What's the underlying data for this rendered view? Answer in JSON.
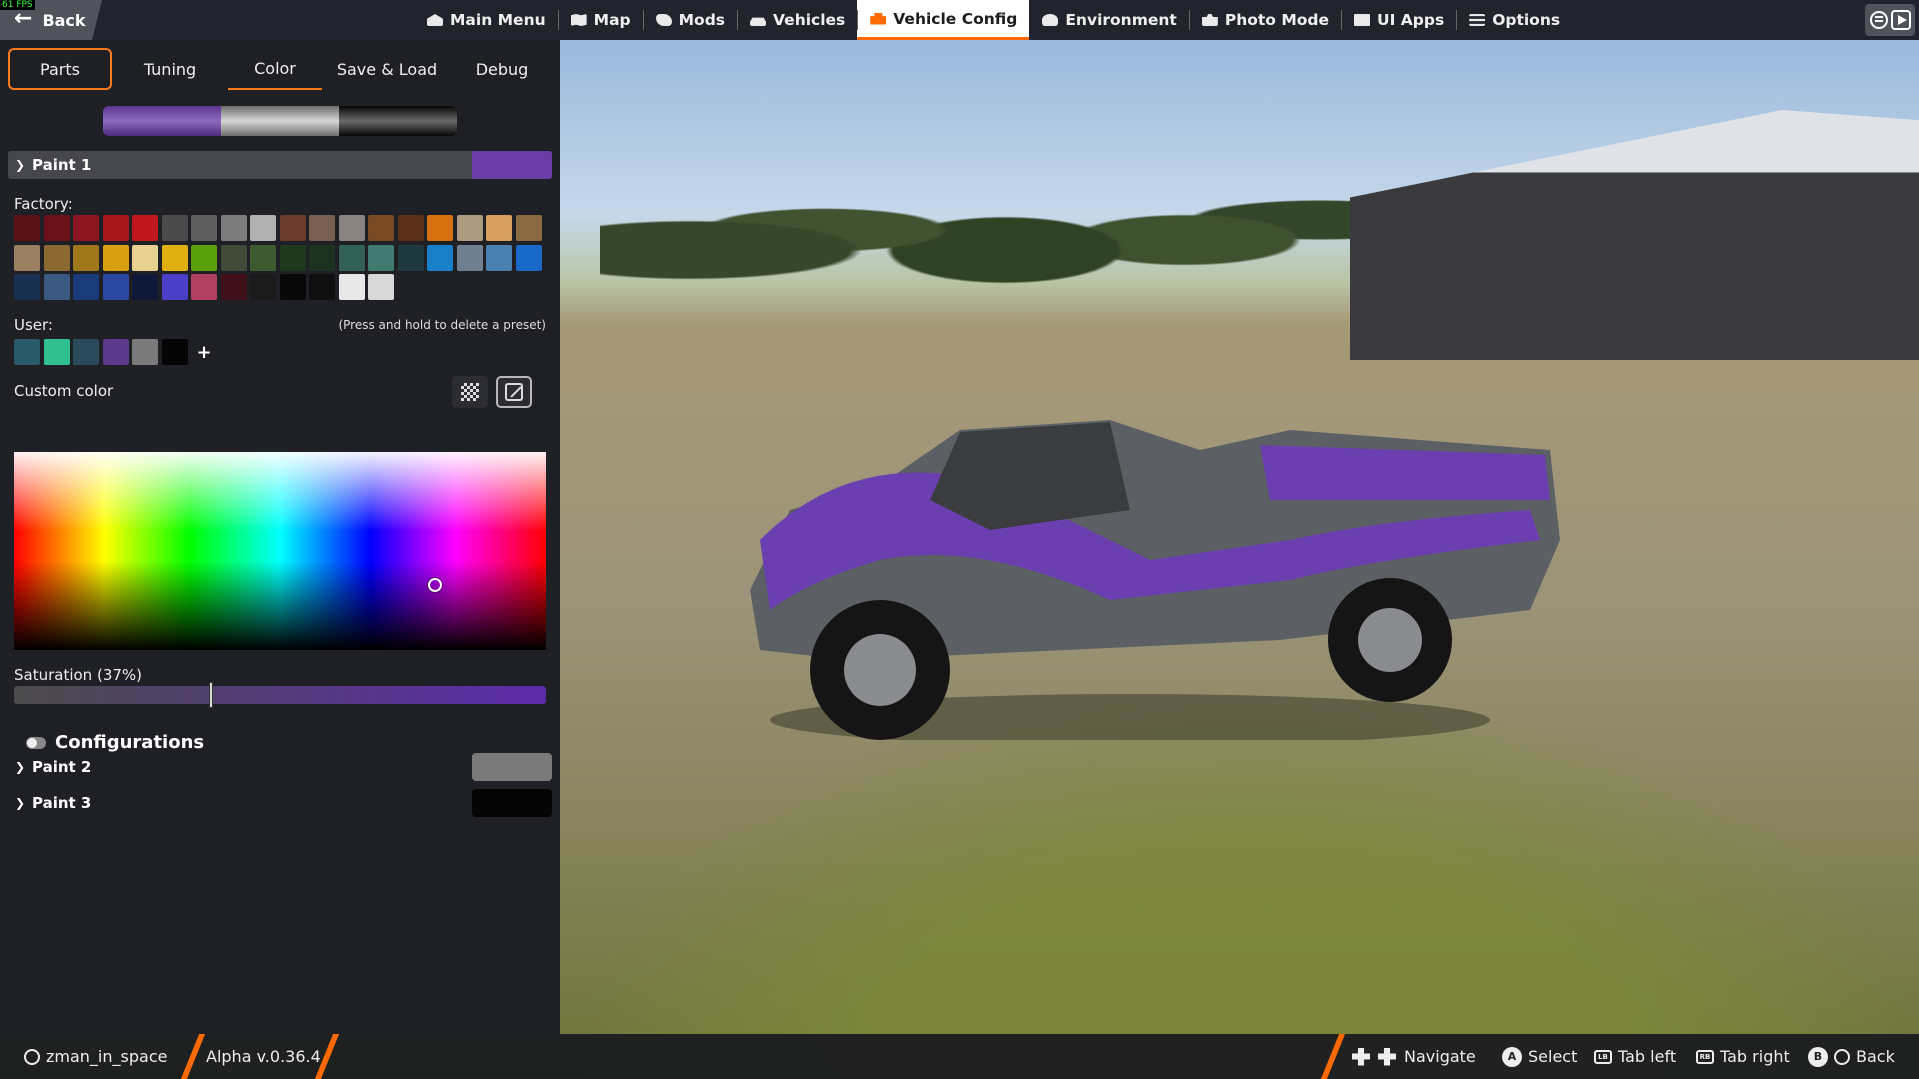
{
  "overlay": {
    "fps": "61 FPS"
  },
  "topbar": {
    "back_label": "Back",
    "nav": [
      {
        "label": "Main Menu",
        "icon": "house-icon"
      },
      {
        "label": "Map",
        "icon": "map-icon"
      },
      {
        "label": "Mods",
        "icon": "puzzle-icon"
      },
      {
        "label": "Vehicles",
        "icon": "car-icon"
      },
      {
        "label": "Vehicle Config",
        "icon": "engine-icon",
        "active": true
      },
      {
        "label": "Environment",
        "icon": "weather-icon"
      },
      {
        "label": "Photo Mode",
        "icon": "camera-icon"
      },
      {
        "label": "UI Apps",
        "icon": "apps-icon"
      },
      {
        "label": "Options",
        "icon": "sliders-icon"
      }
    ]
  },
  "panel": {
    "tabs": [
      "Parts",
      "Tuning",
      "Color",
      "Save & Load",
      "Debug"
    ],
    "active_tab": "Color",
    "preview_colors": [
      "#7a55b0",
      "#b8b8b8",
      "#222222"
    ],
    "paint1": {
      "title": "Paint 1",
      "color": "#6a3da6"
    },
    "factory_label": "Factory:",
    "factory_colors": [
      "#5a1217",
      "#6b1118",
      "#8a1620",
      "#a8161e",
      "#c0161e",
      "#4a4a4a",
      "#5e5e5e",
      "#7c7c7c",
      "#b0b0b0",
      "#6a3a2a",
      "#7a6050",
      "#8a8480",
      "#7a4a24",
      "#5a3016",
      "#d47010",
      "#ad9a80",
      "#d8a060",
      "#8a6a40",
      "#9a8060",
      "#8a6a30",
      "#a0781a",
      "#d8a010",
      "#e8d090",
      "#e0b010",
      "#5aa00a",
      "#404a38",
      "#3e5a30",
      "#1e3a1e",
      "#1e3220",
      "#306058",
      "#407a70",
      "#1e3a40",
      "#1880c8",
      "#708090",
      "#4a80b0",
      "#1a68c8",
      "#1a2e50",
      "#3a5880",
      "#1a3a7a",
      "#2a48a0",
      "#101838",
      "#4a40c8",
      "#b04060",
      "#401018",
      "#1a1a1a",
      "#080808",
      "#101010",
      "#e8e8e8",
      "#d8d8d8"
    ],
    "user_label": "User:",
    "user_hint": "(Press and hold to delete a preset)",
    "user_colors": [
      "#2a5a6a",
      "#30c090",
      "#2a4a5a",
      "#5a3a8a",
      "#7a7a7a",
      "#050505"
    ],
    "user_add_label": "+",
    "custom_color_label": "Custom color",
    "hue_picker": {
      "hue": 285,
      "value": 0.33
    },
    "saturation_label": "Saturation (37%)",
    "saturation": 0.37,
    "configurations_label": "Configurations",
    "paint2": {
      "title": "Paint 2",
      "color": "#7a7a7a"
    },
    "paint3": {
      "title": "Paint 3",
      "color": "#050505"
    }
  },
  "bottombar": {
    "username": "zman_in_space",
    "version": "Alpha v.0.36.4",
    "hints": [
      {
        "key": "dpad",
        "label": "Navigate"
      },
      {
        "key": "A",
        "label": "Select"
      },
      {
        "key": "LB",
        "label": "Tab left"
      },
      {
        "key": "RB",
        "label": "Tab right"
      },
      {
        "key": "B",
        "label": "Back"
      }
    ]
  }
}
